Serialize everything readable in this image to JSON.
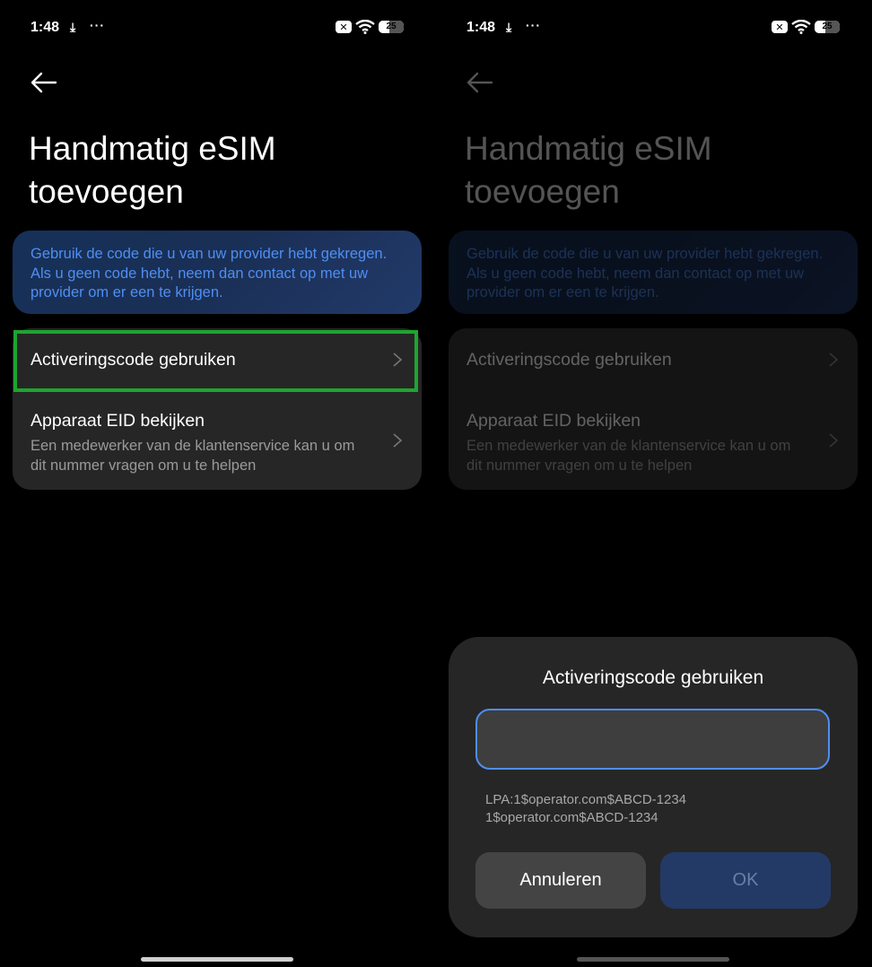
{
  "status_bar": {
    "time": "1:48",
    "download_glyph": "⤓",
    "more_glyph": "···",
    "battery": "25"
  },
  "page": {
    "title_line1": "Handmatig eSIM",
    "title_line2": "toevoegen",
    "info_text": "Gebruik de code die u van uw provider hebt gekregen. Als u geen code hebt, neem dan contact op met uw provider om er een te krijgen.",
    "items": [
      {
        "label": "Activeringscode gebruiken"
      },
      {
        "label": "Apparaat EID bekijken",
        "subtitle": "Een medewerker van de klantenservice kan u om dit nummer vragen om u te helpen"
      }
    ]
  },
  "dialog": {
    "title": "Activeringscode gebruiken",
    "input_value": "",
    "hint_line1": "LPA:1$operator.com$ABCD-1234",
    "hint_line2": "1$operator.com$ABCD-1234",
    "cancel_label": "Annuleren",
    "ok_label": "OK"
  },
  "colors": {
    "accent": "#4f8ef2",
    "highlight": "#1ea52f",
    "surface": "#262626"
  }
}
